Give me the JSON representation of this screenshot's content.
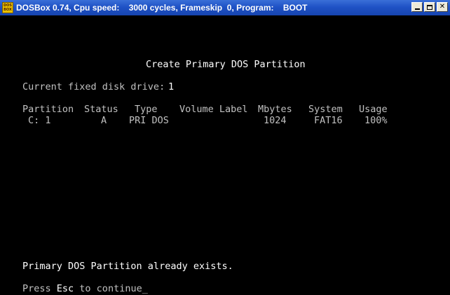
{
  "window": {
    "title": "DOSBox 0.74, Cpu speed:    3000 cycles, Frameskip  0, Program:    BOOT",
    "icon_label_top": "DOS",
    "icon_label_bottom": "BOX",
    "buttons": [
      "minimize",
      "maximize",
      "close"
    ],
    "close_glyph": "✕"
  },
  "screen": {
    "heading": "Create Primary DOS Partition",
    "drive_label": "Current fixed disk drive:",
    "drive_value": "1",
    "table": {
      "headers": [
        "Partition",
        "Status",
        "Type",
        "Volume Label",
        "Mbytes",
        "System",
        "Usage"
      ],
      "rows": [
        {
          "partition": "C: 1",
          "status": "A",
          "type": "PRI DOS",
          "volume_label": "",
          "mbytes": "1024",
          "system": "FAT16",
          "usage": "100%"
        }
      ]
    },
    "message": "Primary DOS Partition already exists.",
    "prompt_prefix": "Press ",
    "prompt_key": "Esc",
    "prompt_suffix": " to continue",
    "cursor": "_"
  },
  "colors": {
    "titlebar": "#1f52c5",
    "screen_bg": "#000000",
    "text": "#c0c0c0",
    "text_bright": "#ffffff"
  }
}
